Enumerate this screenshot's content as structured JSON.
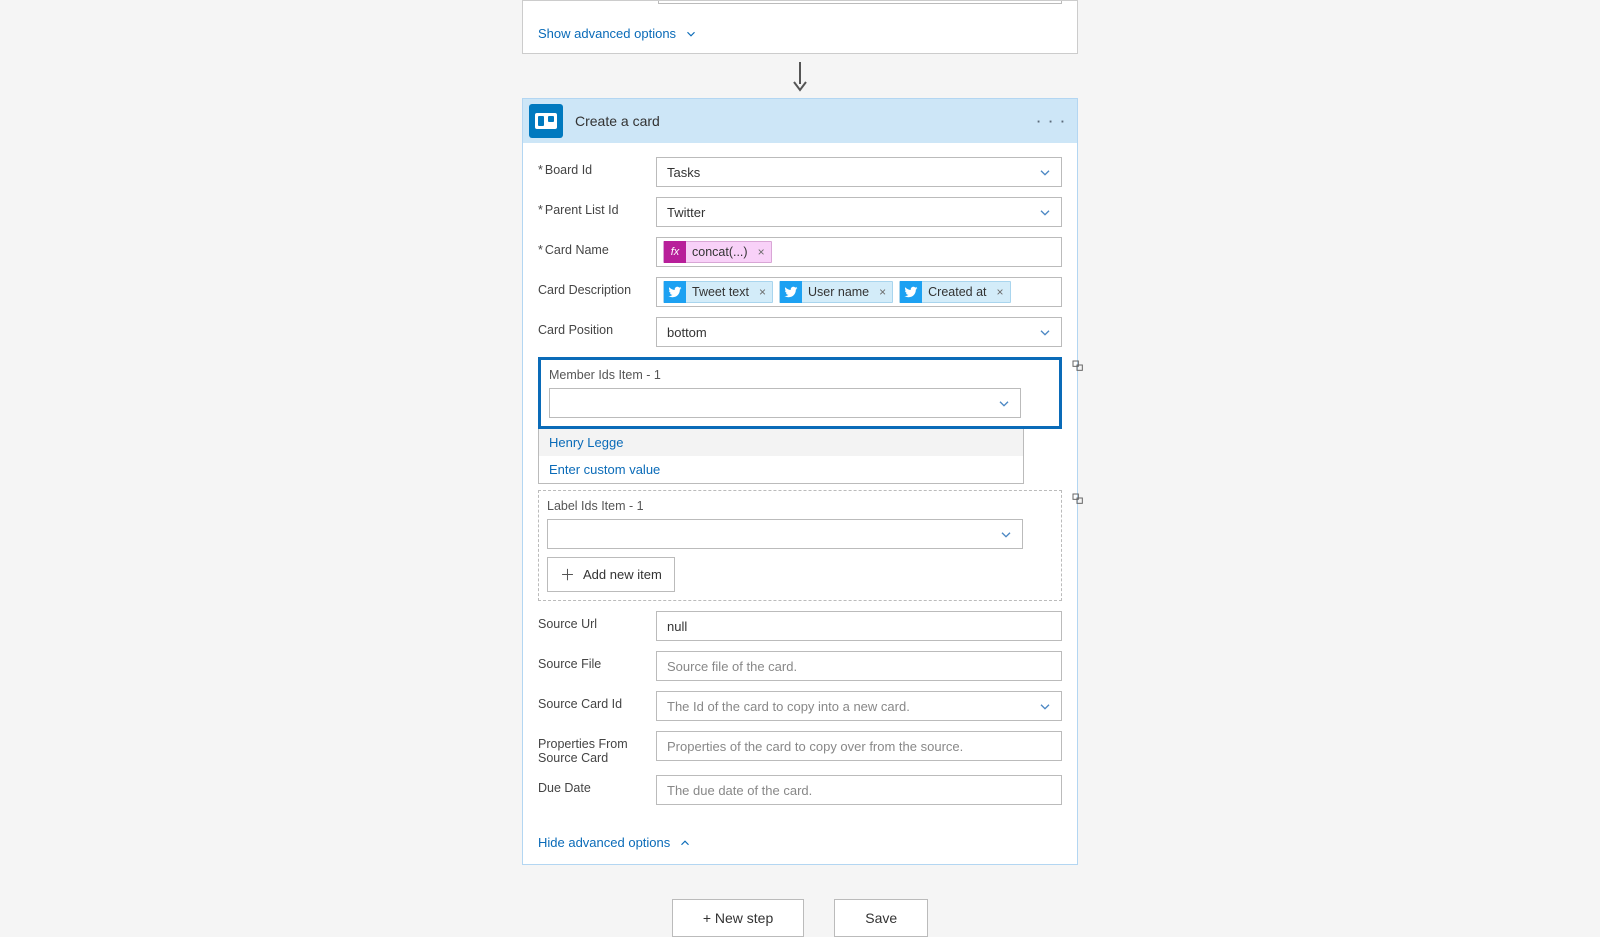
{
  "top_card": {
    "show_advanced": "Show advanced options"
  },
  "action": {
    "title": "Create a card",
    "fields": {
      "board_id": {
        "label": "Board Id",
        "required": true,
        "value": "Tasks"
      },
      "parent_list_id": {
        "label": "Parent List Id",
        "required": true,
        "value": "Twitter"
      },
      "card_name": {
        "label": "Card Name",
        "required": true,
        "tokens": [
          {
            "kind": "fx",
            "text": "concat(...)"
          }
        ]
      },
      "card_desc": {
        "label": "Card Description",
        "required": false,
        "tokens": [
          {
            "kind": "tw",
            "text": "Tweet text"
          },
          {
            "kind": "tw",
            "text": "User name"
          },
          {
            "kind": "tw",
            "text": "Created at"
          }
        ]
      },
      "card_position": {
        "label": "Card Position",
        "value": "bottom"
      },
      "member_ids": {
        "title": "Member Ids Item - 1",
        "dropdown": {
          "options": [
            "Henry Legge",
            "Enter custom value"
          ],
          "hover_index": 0
        }
      },
      "label_ids": {
        "title": "Label Ids Item - 1"
      },
      "add_item_label": "Add new item",
      "source_url": {
        "label": "Source Url",
        "value": "null"
      },
      "source_file": {
        "label": "Source File",
        "placeholder": "Source file of the card."
      },
      "source_card": {
        "label": "Source Card Id",
        "placeholder": "The Id of the card to copy into a new card."
      },
      "props_from": {
        "label": "Properties From Source Card",
        "placeholder": "Properties of the card to copy over from the source."
      },
      "due_date": {
        "label": "Due Date",
        "placeholder": "The due date of the card."
      }
    },
    "hide_advanced": "Hide advanced options"
  },
  "footer": {
    "new_step": "+ New step",
    "save": "Save"
  },
  "icons": {
    "fx_label": "fx"
  },
  "colors": {
    "accent": "#0a6bb8",
    "trello": "#0079bf",
    "twitter": "#1da1f2",
    "fx": "#b81f9a"
  }
}
